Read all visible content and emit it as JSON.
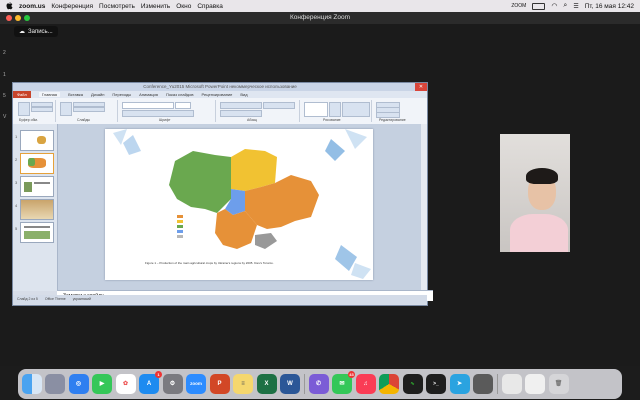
{
  "menubar": {
    "app": "zoom.us",
    "items": [
      "Конференция",
      "Посмотреть",
      "Изменить",
      "Окно",
      "Справка"
    ],
    "status_zoom": "ZOOM",
    "datetime": "Пт, 16 мая  12:42"
  },
  "window": {
    "title": "Конференция Zoom"
  },
  "recording": {
    "label": "Запись..."
  },
  "ppt": {
    "title": "Conference_Yu2015 Microsoft PowerPoint некоммерческое использование",
    "tabs": [
      "Файл",
      "Главная",
      "Вставка",
      "Дизайн",
      "Переходы",
      "Анимация",
      "Показ слайдов",
      "Рецензирование",
      "Вид"
    ],
    "ribbon_groups": [
      "Буфер обм.",
      "Слайды",
      "Шрифт",
      "Абзац",
      "Рисование",
      "Редактирование"
    ],
    "figure_caption": "Figure 1 – Production of the main agricultural crops by Ukraine's regions by 2005. Kiev's Toronto.",
    "notes": "Заметки к слайду",
    "status": [
      "Слайд 2 из 5",
      "Office Theme",
      "украинский"
    ]
  },
  "colors": {
    "map_green": "#6aa84f",
    "map_yellow": "#f1c232",
    "map_orange": "#e69138",
    "map_blue": "#6d9eeb",
    "map_gray": "#999999",
    "accent": "#2d8cff"
  },
  "dock": {
    "icons": [
      "finder-icon",
      "launchpad-icon",
      "safari-icon",
      "facetime-icon",
      "photos-icon",
      "appstore-icon",
      "system-settings-icon",
      "zoom-icon",
      "powerpoint-icon",
      "notes-icon",
      "excel-icon",
      "word-icon",
      "viber-icon",
      "messages-icon",
      "music-icon",
      "chrome-icon",
      "activity-monitor-icon",
      "terminal-icon",
      "telegram-icon",
      "preview-icon",
      "downloads-icon",
      "folder-icon",
      "trash-icon"
    ],
    "badges": {
      "appstore": "1",
      "messages": "43"
    }
  }
}
